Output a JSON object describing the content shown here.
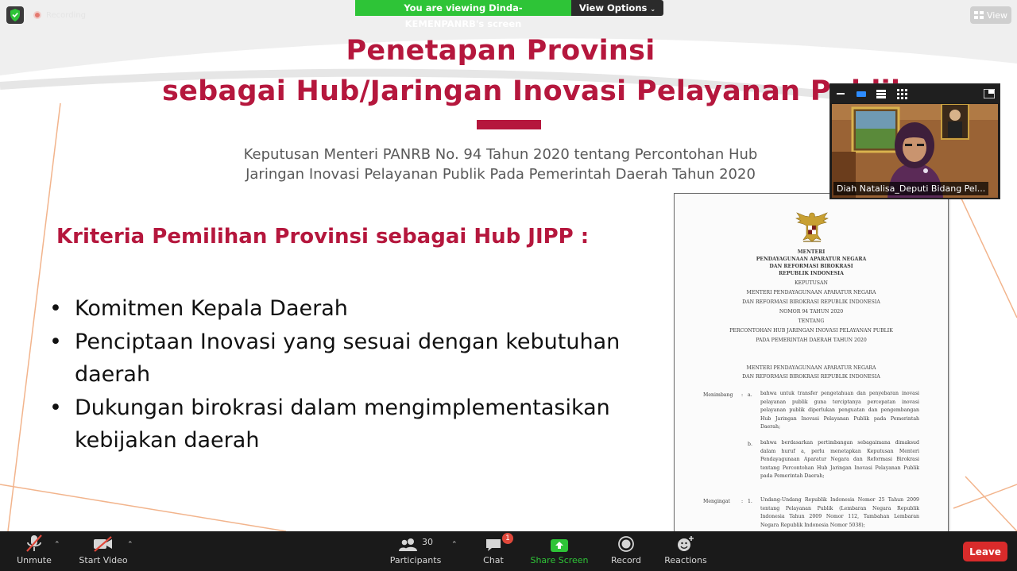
{
  "slide": {
    "title_line1": "Penetapan Provinsi",
    "title_line2": "sebagai Hub/Jaringan Inovasi Pelayanan Publik",
    "subtitle_line1": "Keputusan Menteri PANRB No. 94 Tahun 2020 tentang Percontohan Hub",
    "subtitle_line2": "Jaringan Inovasi Pelayanan Publik Pada Pemerintah Daerah Tahun 2020",
    "criteria_heading": "Kriteria Pemilihan Provinsi sebagai Hub JIPP :",
    "bullets": [
      "Komitmen Kepala Daerah",
      "Penciptaan Inovasi yang sesuai dengan kebutuhan daerah",
      "Dukungan birokrasi dalam mengimplementasikan kebijakan daerah"
    ],
    "accent_color": "#b5173d"
  },
  "document": {
    "header": [
      "MENTERI",
      "PENDAYAGUNAAN APARATUR NEGARA",
      "DAN REFORMASI BIROKRASI",
      "REPUBLIK INDONESIA"
    ],
    "keputusan": "KEPUTUSAN",
    "menteri_line1": "MENTERI PENDAYAGUNAAN APARATUR NEGARA",
    "menteri_line2": "DAN REFORMASI BIROKRASI REPUBLIK INDONESIA",
    "nomor": "NOMOR 94 TAHUN 2020",
    "tentang": "TENTANG",
    "subject_line1": "PERCONTOHAN HUB JARINGAN INOVASI PELAYANAN PUBLIK",
    "subject_line2": "PADA PEMERINTAH DAERAH TAHUN 2020",
    "issuer_line1": "MENTERI PENDAYAGUNAAN APARATUR NEGARA",
    "issuer_line2": "DAN REFORMASI BIROKRASI REPUBLIK INDONESIA",
    "menimbang_label": "Menimbang",
    "menimbang_sep": ":",
    "point_a": "a.",
    "point_a_text": "bahwa untuk transfer pengetahuan dan penyebaran inovasi pelayanan publik guna terciptanya percepatan inovasi pelayanan publik diperlukan penguatan dan pengembangan Hub Jaringan Inovasi Pelayanan Publik pada Pemerintah Daerah;",
    "point_b": "b.",
    "point_b_text": "bahwa berdasarkan pertimbangan sebagaimana dimaksud dalam huruf a, perlu menetapkan Keputusan Menteri Pendayagunaan Aparatur Negara dan Reformasi Birokrasi tentang Percontohan Hub Jaringan Inovasi Pelayanan Publik pada Pemerintah Daerah;",
    "mengingat_label": "Mengingat",
    "mengingat_sep": ":",
    "point_1": "1.",
    "point_1_text": "Undang-Undang Republik Indonesia Nomor 25 Tahun 2009 tentang Pelayanan Publik (Lembaran Negara Republik Indonesia Tahun 2009 Nomor 112, Tambahan Lembaran Negara Republik Indonesia Nomor 5038);"
  },
  "zoom": {
    "recording_label": "Recording",
    "viewing_banner": "You are viewing Dinda-KEMENPANRB's screen",
    "view_options_label": "View Options",
    "view_button_label": "View",
    "participant_name": "Diah Natalisa_Deputi Bidang Pel...",
    "participants_count": "30",
    "chat_badge": "1",
    "share_color": "#2ec437",
    "leave_color": "#d92b2b"
  },
  "toolbar": {
    "unmute": "Unmute",
    "start_video": "Start Video",
    "participants": "Participants",
    "chat": "Chat",
    "share_screen": "Share Screen",
    "record": "Record",
    "reactions": "Reactions",
    "leave": "Leave"
  }
}
